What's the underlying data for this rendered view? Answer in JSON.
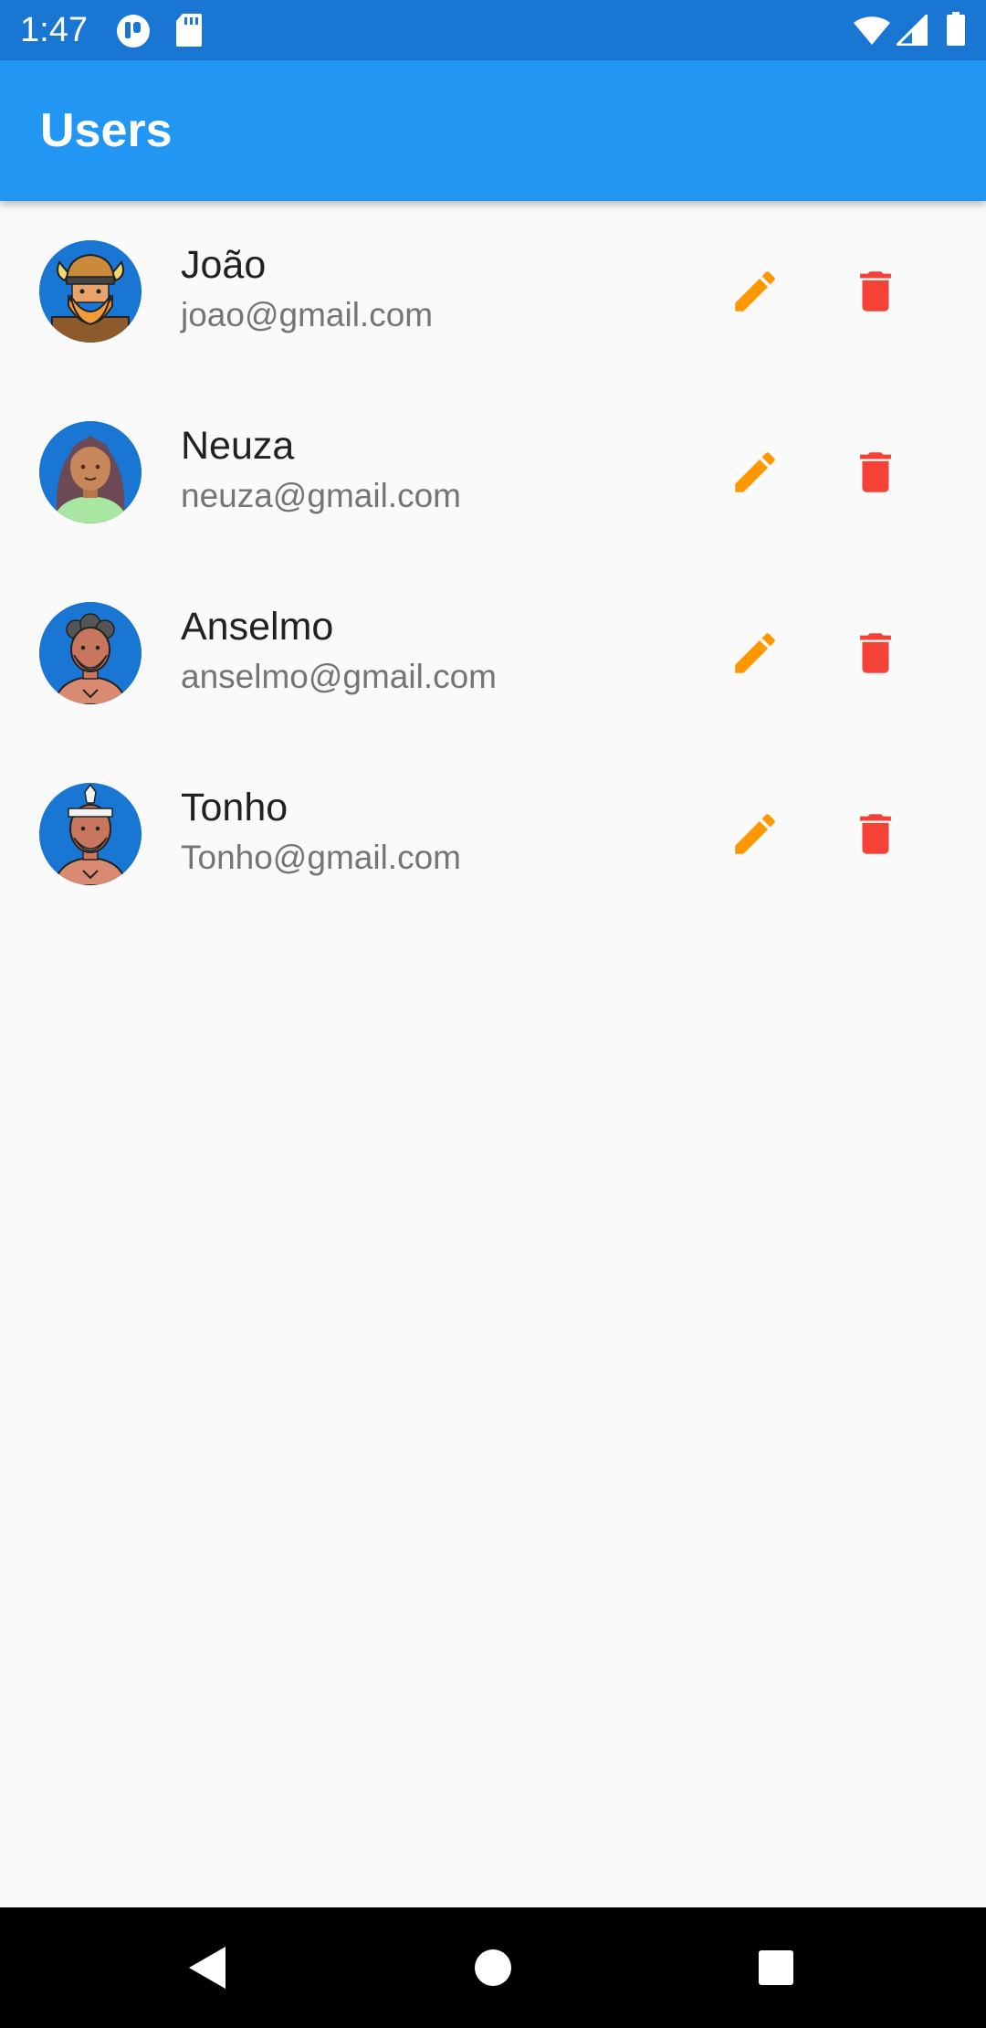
{
  "status_bar": {
    "time": "1:47",
    "icons": [
      "notification-app-icon",
      "sd-card-icon",
      "wifi-icon",
      "cell-signal-icon",
      "battery-icon"
    ]
  },
  "app_bar": {
    "title": "Users",
    "color": "#2196f3"
  },
  "users": [
    {
      "name": "João",
      "email": "joao@gmail.com",
      "avatar": "viking-avatar"
    },
    {
      "name": "Neuza",
      "email": "neuza@gmail.com",
      "avatar": "woman-avatar"
    },
    {
      "name": "Anselmo",
      "email": "anselmo@gmail.com",
      "avatar": "old-man-avatar"
    },
    {
      "name": "Tonho",
      "email": "Tonho@gmail.com",
      "avatar": "tribal-man-avatar"
    }
  ],
  "actions": {
    "edit_icon": "pencil-icon",
    "edit_color": "#ff9800",
    "delete_icon": "trash-icon",
    "delete_color": "#f44336"
  },
  "nav_bar": {
    "buttons": [
      "back-icon",
      "home-icon",
      "recents-icon"
    ]
  }
}
